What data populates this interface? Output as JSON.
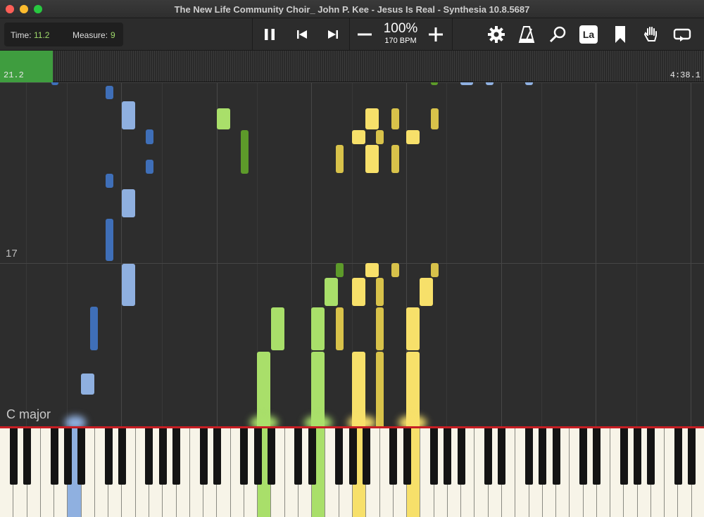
{
  "window": {
    "title": "The New Life Community Choir_ John P. Kee - Jesus Is Real - Synthesia 10.8.5687"
  },
  "readout": {
    "time_label": "Time:",
    "time_value": "11.2",
    "measure_label": "Measure:",
    "measure_value": "9"
  },
  "speed": {
    "percent": "100%",
    "bpm": "170 BPM"
  },
  "toolbar_icons": [
    "pause-icon",
    "previous-icon",
    "next-icon",
    "minus-icon",
    "plus-icon",
    "gear-icon",
    "metronome-icon",
    "magnifier-icon",
    "note-label-icon",
    "bookmark-icon",
    "hand-icon",
    "loop-icon"
  ],
  "note_label_text": "La",
  "timeline": {
    "current": "21.2",
    "total": "4:38.1",
    "progress": 0.075
  },
  "roll": {
    "measure_number": "17",
    "key_signature": "C major"
  },
  "colors": {
    "left_hand_dark": "#3f6fb8",
    "left_hand_light": "#8fb0e0",
    "green_light": "#a9df6a",
    "green_dark": "#5d9a2a",
    "yellow": "#f7e06a",
    "yellow_dark": "#d8c24a",
    "keyboard_rail": "#c81e24"
  },
  "pressed_keys": [
    {
      "hand": "left",
      "color": "#8fb0e0"
    },
    {
      "hand": "right",
      "color": "#a9df6a"
    },
    {
      "hand": "right",
      "color": "#a9df6a"
    },
    {
      "hand": "right",
      "color": "#f7e06a"
    },
    {
      "hand": "right",
      "color": "#f7e06a"
    }
  ]
}
